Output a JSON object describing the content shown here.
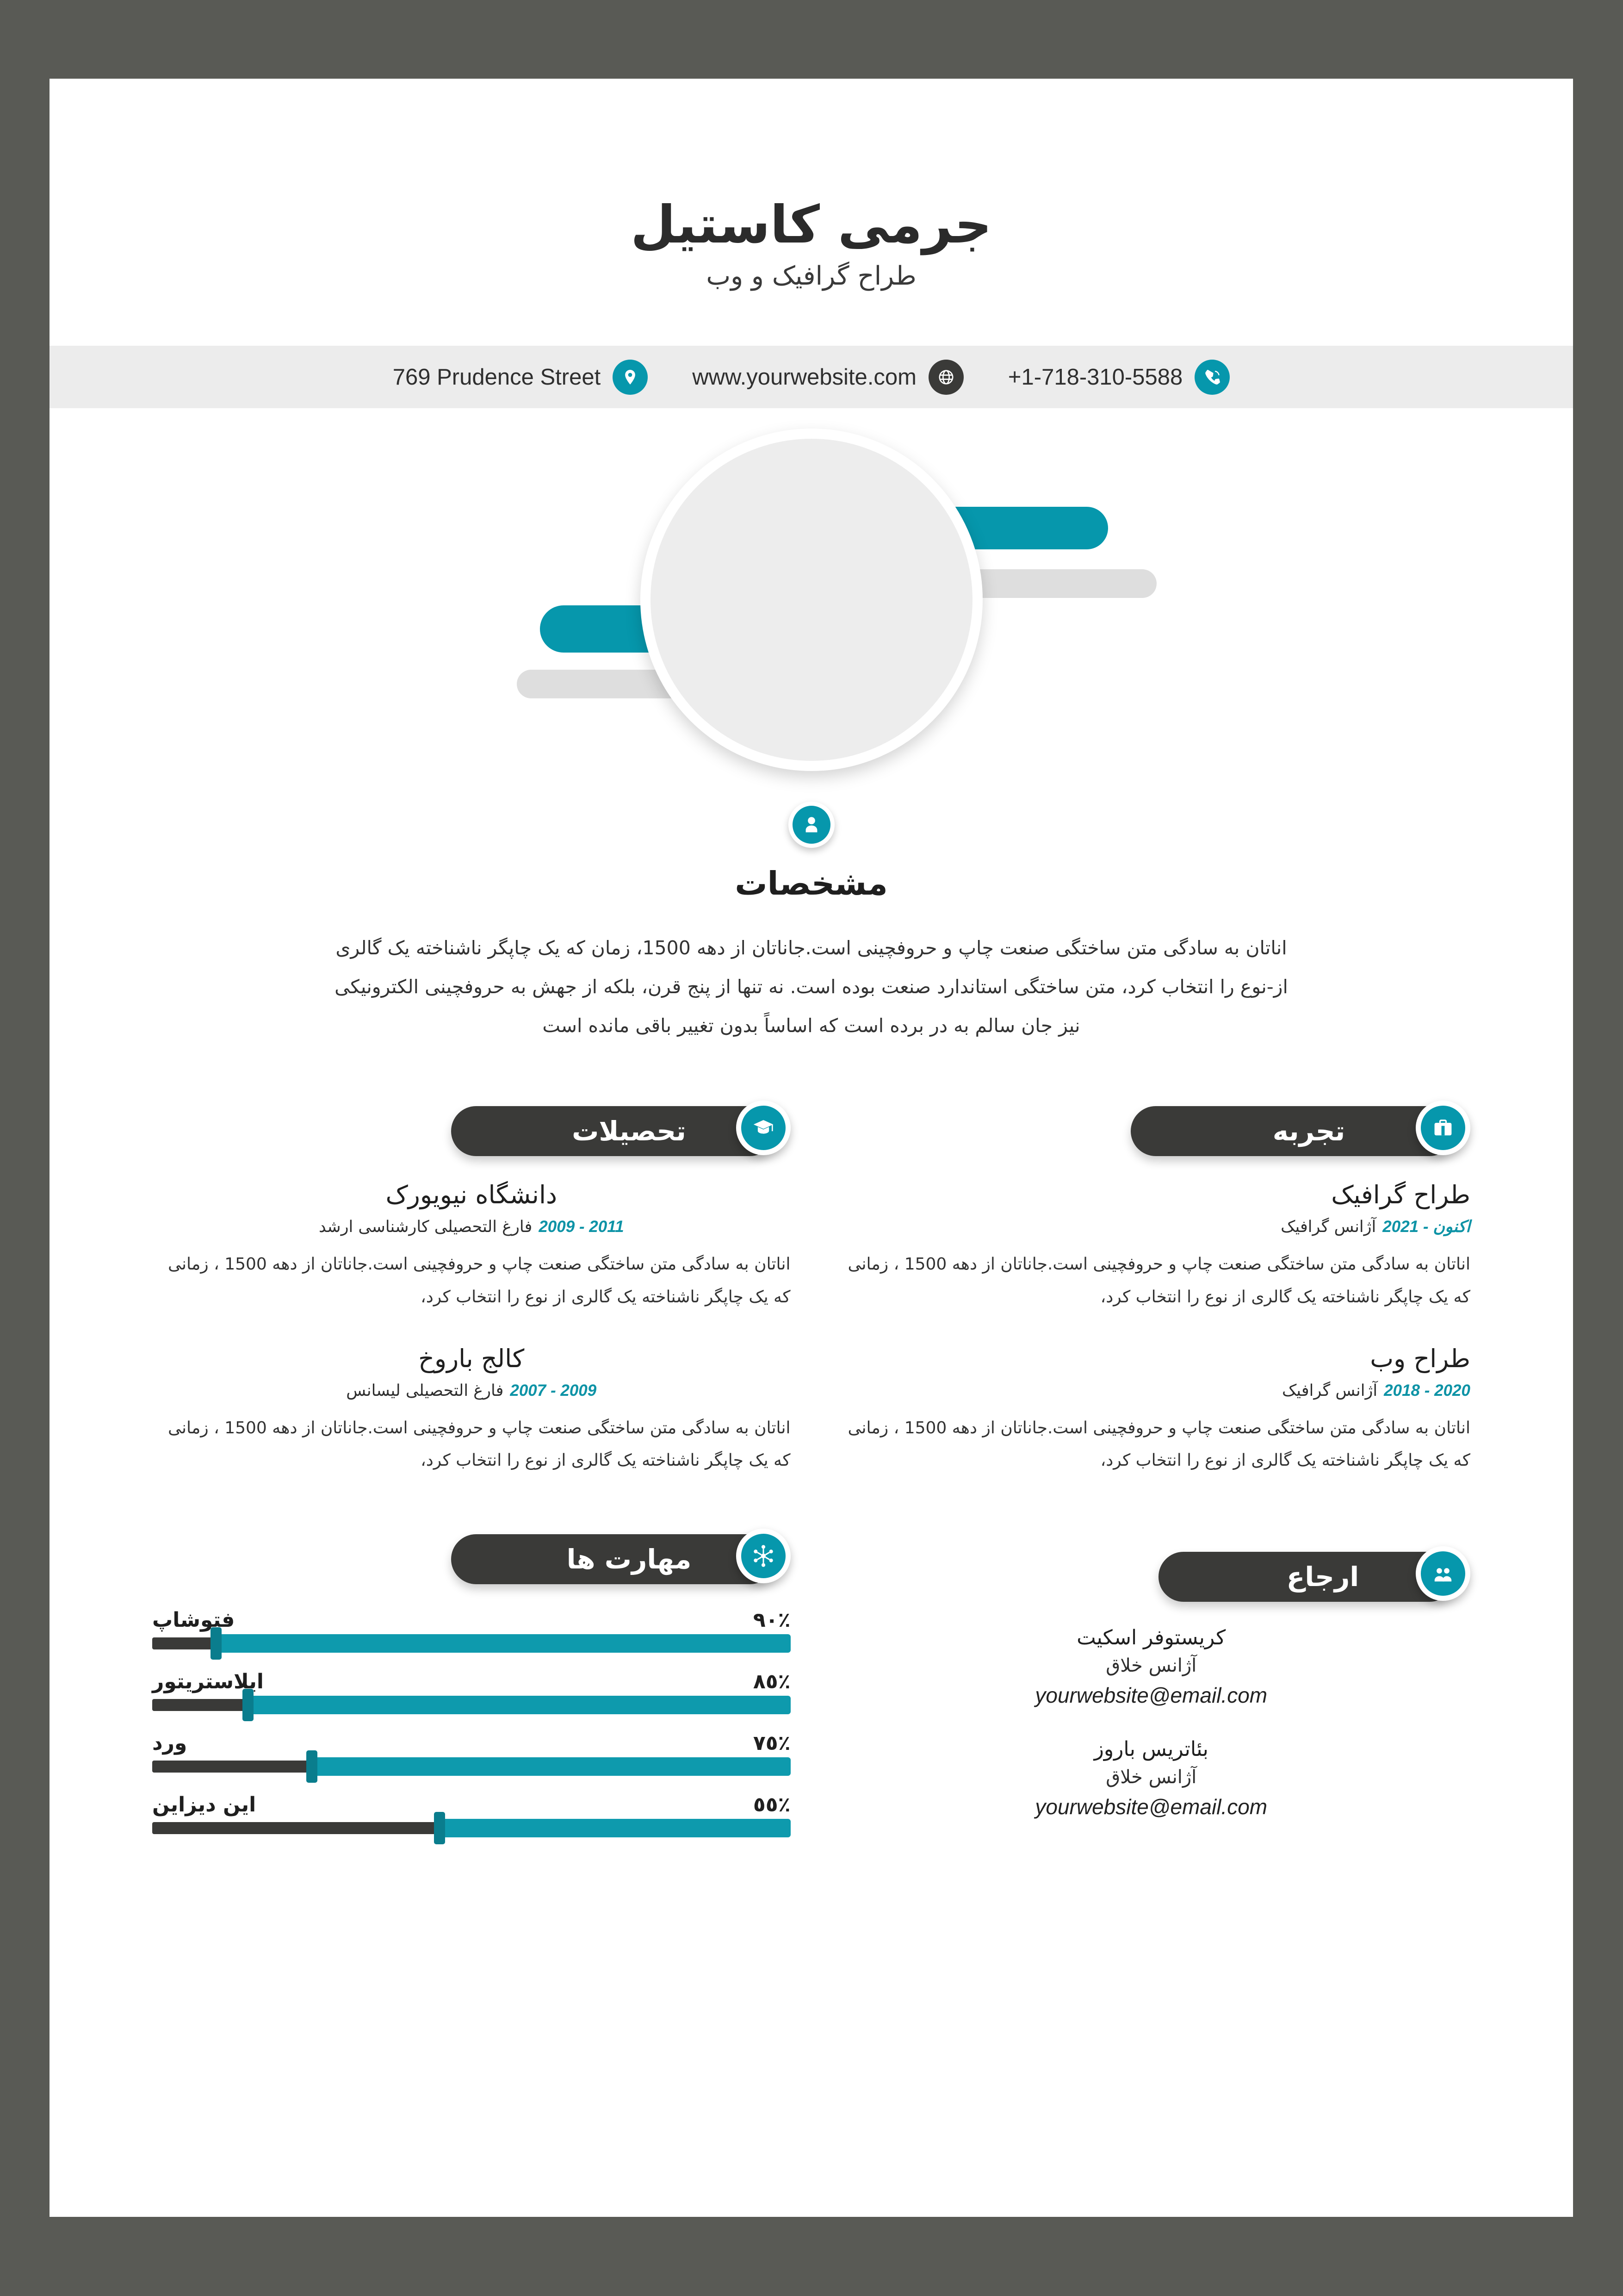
{
  "theme": {
    "accent_teal": "#0697ac",
    "dark": "#3a3a38",
    "page_bg": "#ffffff",
    "outer_bg": "#595a55",
    "strip_bg": "#ececec"
  },
  "header": {
    "name": "جرمی کاستیل",
    "tagline": "طراح گرافیک و وب"
  },
  "contact": {
    "phone": "+1-718-310-5588",
    "website": "www.yourwebsite.com",
    "address": "769 Prudence Street",
    "phone_icon": "phone-icon",
    "website_icon": "globe-icon",
    "address_icon": "location-pin-icon"
  },
  "photo": {
    "placeholder_label": "photo-placeholder"
  },
  "profile": {
    "icon": "person-icon",
    "title": "مشخصات",
    "text": "اناتان  به سادگی متن ساختگی صنعت چاپ و حروفچینی است.جاناتان از دهه 1500، زمان که یک چاپگر ناشناخته یک گالری از-نوع را انتخاب کرد، متن ساختگی استاندارد صنعت بوده است. نه تنها از پنج قرن، بلکه از جهش به حروفچینی الکترونیکی نیز جان سالم به در برده است که اساساً بدون تغییر باقی مانده است"
  },
  "experience": {
    "title": "تجربه",
    "icon": "briefcase-icon",
    "entries": [
      {
        "role": "طراح گرافیک",
        "org": "آژانس گرافیک",
        "period": "اکنون - 2021",
        "desc": "اناتان  به سادگی متن ساختگی صنعت چاپ و حروفچینی است.جاناتان از دهه 1500 ، زمانی که یک چاپگر ناشناخته یک گالری از نوع را انتخاب کرد،"
      },
      {
        "role": "طراح وب",
        "org": "آژانس گرافیک",
        "period": "2020 - 2018",
        "desc": "اناتان  به سادگی متن ساختگی صنعت چاپ و حروفچینی است.جاناتان از دهه 1500 ، زمانی که یک چاپگر ناشناخته یک گالری از نوع را انتخاب کرد،"
      }
    ]
  },
  "education": {
    "title": "تحصیلات",
    "icon": "graduation-cap-icon",
    "entries": [
      {
        "school": "دانشگاه نیویورک",
        "degree": "فارغ التحصیلی کارشناسی ارشد",
        "period": "2011 - 2009",
        "desc": "اناتان  به سادگی متن ساختگی صنعت چاپ و حروفچینی است.جاناتان از دهه 1500 ، زمانی که یک چاپگر ناشناخته یک گالری از نوع را انتخاب کرد،"
      },
      {
        "school": "کالج باروخ",
        "degree": "فارغ التحصیلی لیسانس",
        "period": "2009 - 2007",
        "desc": "اناتان  به سادگی متن ساختگی صنعت چاپ و حروفچینی است.جاناتان از دهه 1500 ، زمانی که یک چاپگر ناشناخته یک گالری از نوع را انتخاب کرد،"
      }
    ]
  },
  "skills": {
    "title": "مهارت ها",
    "icon": "skills-network-icon",
    "items": [
      {
        "name": "فتوشاپ",
        "percent_label": "٩٠٪",
        "percent": 90
      },
      {
        "name": "ایلاستریتور",
        "percent_label": "٨٥٪",
        "percent": 85
      },
      {
        "name": "ورد",
        "percent_label": "٧٥٪",
        "percent": 75
      },
      {
        "name": "این دیزاین",
        "percent_label": "٥٥٪",
        "percent": 55
      }
    ]
  },
  "references": {
    "title": "ارجاع",
    "icon": "people-icon",
    "entries": [
      {
        "name": "کریستوفر اسکیت",
        "org": "آژانس خلاق",
        "email": "yourwebsite@email.com"
      },
      {
        "name": "بئاتریس باروز",
        "org": "آژانس خلاق",
        "email": "yourwebsite@email.com"
      }
    ]
  }
}
